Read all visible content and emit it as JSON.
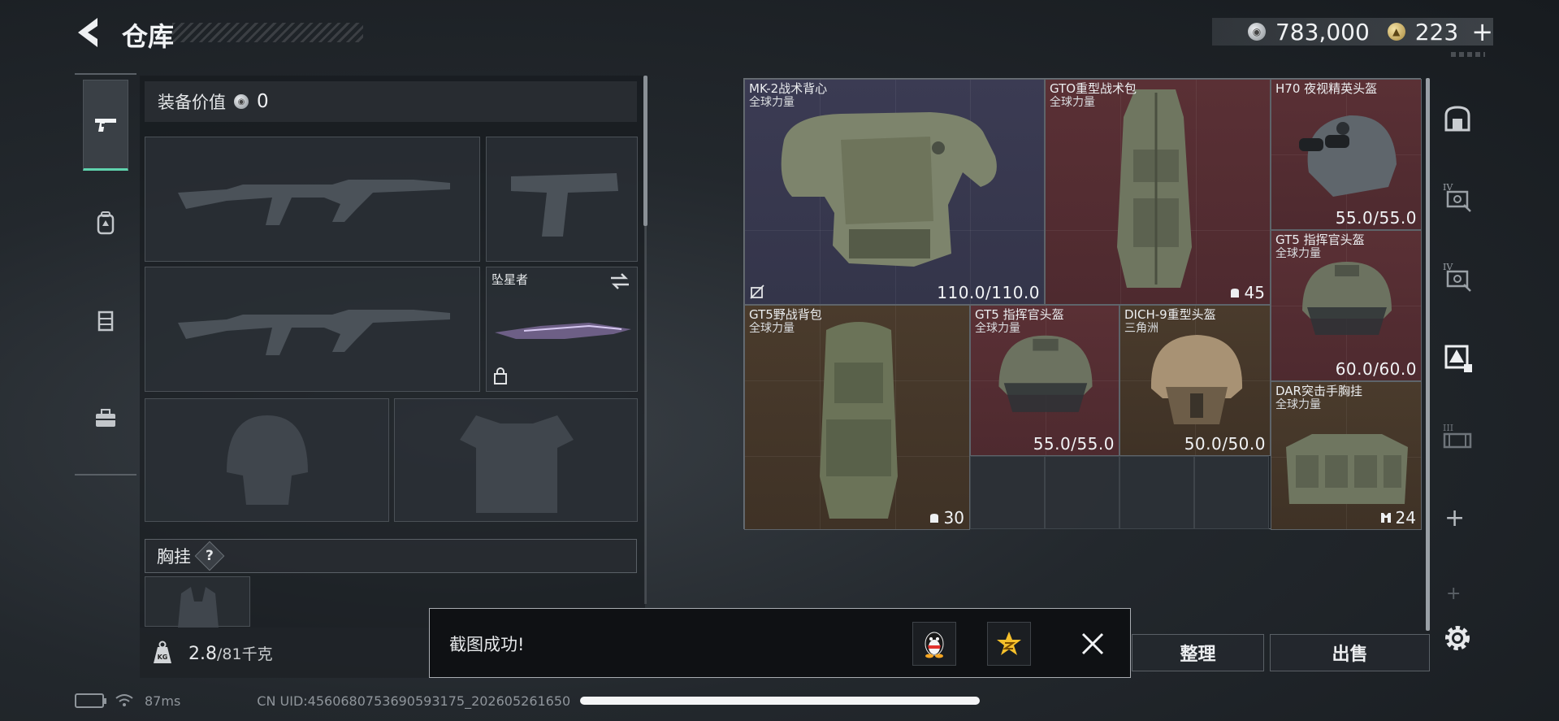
{
  "header": {
    "title": "仓库",
    "back_icon": "back-arrow-icon",
    "currencies": [
      {
        "icon": "silver-coin-icon",
        "value": "783,000"
      },
      {
        "icon": "gold-coin-icon",
        "value": "223"
      }
    ],
    "add_label": "+"
  },
  "left_rail": {
    "tabs": [
      {
        "icon": "pistol-icon",
        "active": true
      },
      {
        "icon": "backpack-icon",
        "active": false
      },
      {
        "icon": "chest-rig-icon",
        "active": false
      },
      {
        "icon": "toolbox-icon",
        "active": false
      }
    ]
  },
  "loadout": {
    "equip_value_label": "装备价值",
    "equip_value": "0",
    "melee_name": "坠星者",
    "chest_rig_label": "胸挂",
    "chest_rig_help": "?",
    "weight_current": "2.8",
    "weight_max": "/81千克",
    "weight_icon_label": "KG"
  },
  "stash": {
    "items": [
      {
        "name": "MK-2战术背心",
        "sub": "全球力量",
        "value": "110.0/110.0",
        "rarity": "purple"
      },
      {
        "name": "GTO重型战术包",
        "sub": "全球力量",
        "value": "45",
        "rarity": "red"
      },
      {
        "name": "H70 夜视精英头盔",
        "sub": "",
        "value": "55.0/55.0",
        "rarity": "red"
      },
      {
        "name": "GT5 指挥官头盔",
        "sub": "全球力量",
        "value": "60.0/60.0",
        "rarity": "red"
      },
      {
        "name": "GT5野战背包",
        "sub": "全球力量",
        "value": "30",
        "rarity": "gold"
      },
      {
        "name": "GT5 指挥官头盔",
        "sub": "全球力量",
        "value": "55.0/55.0",
        "rarity": "red"
      },
      {
        "name": "DICH-9重型头盔",
        "sub": "三角洲",
        "value": "50.0/50.0",
        "rarity": "gold"
      },
      {
        "name": "DAR突击手胸挂",
        "sub": "全球力量",
        "value": "24",
        "rarity": "gold"
      }
    ]
  },
  "right_rail": {
    "tabs": [
      {
        "icon": "stash-home-icon"
      },
      {
        "icon": "stash-tier-iv-icon",
        "label": "IV"
      },
      {
        "icon": "stash-tier-iv-icon",
        "label": "IV"
      },
      {
        "icon": "stash-special-icon",
        "label": ""
      },
      {
        "icon": "stash-tier-iii-icon",
        "label": "III"
      }
    ],
    "add_label": "+"
  },
  "actions": {
    "sort_label": "整理",
    "sell_label": "出售"
  },
  "toast": {
    "message": "截图成功!",
    "qq_icon": "qq-penguin-icon",
    "qzone_icon": "qzone-star-icon",
    "close_icon": "close-icon"
  },
  "status_bar": {
    "ping": "87ms",
    "uid": "CN UID:4560680753690593175_202605261650"
  },
  "colors": {
    "accent_green": "#5fd3ae",
    "rarity_purple": "#3b3b53",
    "rarity_red": "#5a3035",
    "rarity_gold": "#4a3b2c"
  }
}
